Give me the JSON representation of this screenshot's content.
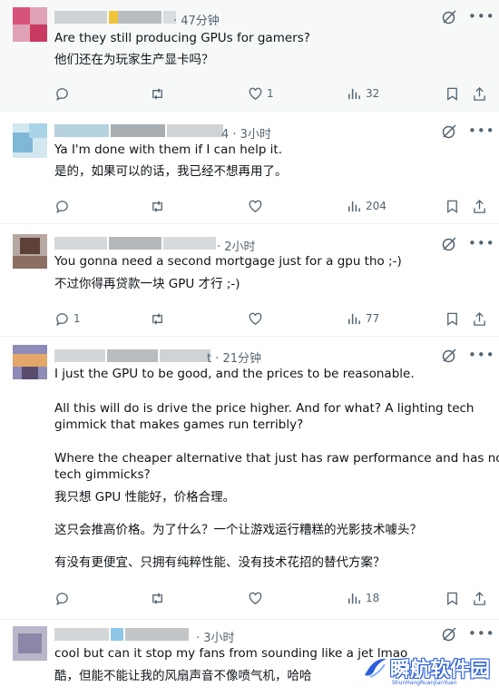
{
  "tweets": [
    {
      "time": "· 47分钟",
      "lines": [
        "Are they still producing GPUs for gamers?",
        "他们还在为玩家生产显卡吗？"
      ],
      "actions": {
        "reply": "",
        "retweet": "",
        "like": "1",
        "views": "32"
      }
    },
    {
      "time": "4 · 3小时",
      "lines": [
        "Ya I'm done with them if I can help it.",
        "是的，如果可以的话，我已经不想再用了。"
      ],
      "actions": {
        "reply": "",
        "retweet": "",
        "like": "",
        "views": "204"
      }
    },
    {
      "time": "· 2小时",
      "lines": [
        "You gonna need a second mortgage just for a gpu tho ;-)",
        "不过你得再贷款一块 GPU 才行 ;-)"
      ],
      "actions": {
        "reply": "1",
        "retweet": "",
        "like": "",
        "views": "77"
      }
    },
    {
      "time": "t · 21分钟",
      "lines": [
        "I just the GPU to be good, and the prices to be reasonable.",
        "All this will do is drive the price higher. And for what? A lighting tech",
        "gimmick that makes games run terribly?",
        "Where the cheaper alternative that just has raw performance and has no",
        "tech gimmicks?",
        "我只想 GPU 性能好，价格合理。",
        "这只会推高价格。为了什么？一个让游戏运行糟糕的光影技术噱头？",
        "有没有更便宜、只拥有纯粹性能、没有技术花招的替代方案？"
      ],
      "actions": {
        "reply": "",
        "retweet": "",
        "like": "",
        "views": "18"
      }
    },
    {
      "time": "· 3小时",
      "lines": [
        "cool but can it stop my fans from sounding like a jet lmao",
        "酷，但能不能让我的风扇声音不像喷气机，哈哈"
      ],
      "actions": {
        "reply": "",
        "retweet": "",
        "like": "",
        "views": ""
      }
    }
  ],
  "watermark": {
    "title": "瞬航软件园",
    "subtitle": "ShunHangRuanJianYuan"
  },
  "colors": {
    "text": "#0f1419",
    "muted": "#536471",
    "divider": "#eff3f4",
    "highlight_bg": "#f7f9f9",
    "watermark": "#2b5fd9"
  }
}
